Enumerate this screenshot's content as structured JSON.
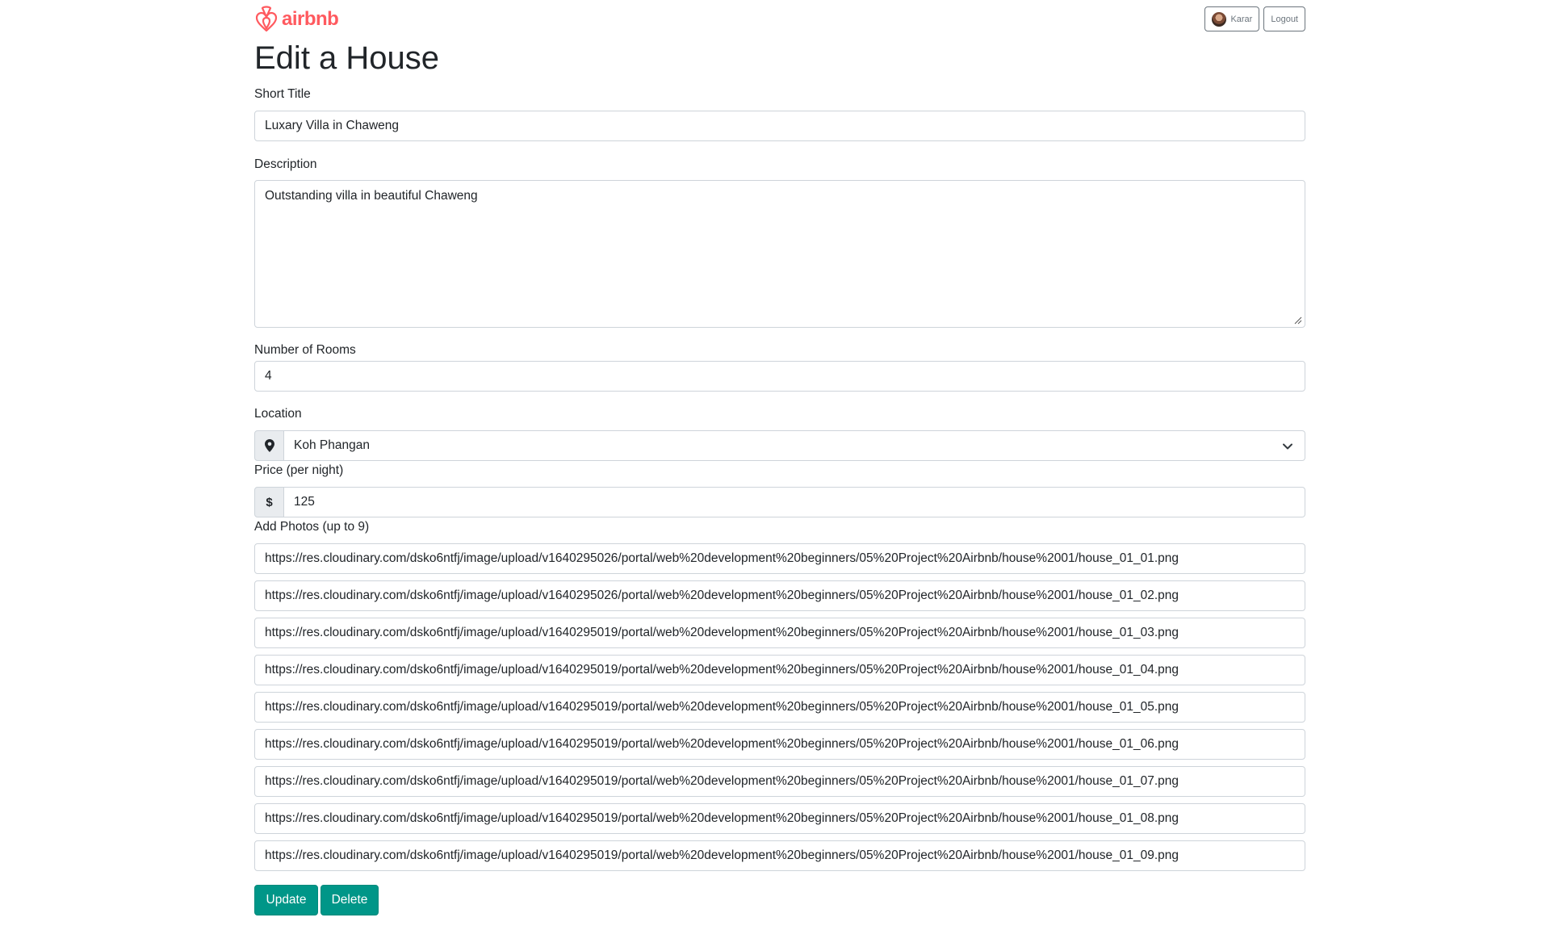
{
  "brand": {
    "name": "airbnb",
    "color": "#ff5a5f"
  },
  "nav": {
    "user_label": "Karar",
    "logout_label": "Logout"
  },
  "page": {
    "title": "Edit a House"
  },
  "form": {
    "title_label": "Short Title",
    "title_value": "Luxary Villa in Chaweng",
    "description_label": "Description",
    "description_value": "Outstanding villa in beautiful Chaweng",
    "rooms_label": "Number of Rooms",
    "rooms_value": "4",
    "location_label": "Location",
    "location_value": "Koh Phangan",
    "price_label": "Price (per night)",
    "price_prefix": "$",
    "price_value": "125",
    "photos_label": "Add Photos (up to 9)",
    "photos": [
      "https://res.cloudinary.com/dsko6ntfj/image/upload/v1640295026/portal/web%20development%20beginners/05%20Project%20Airbnb/house%2001/house_01_01.png",
      "https://res.cloudinary.com/dsko6ntfj/image/upload/v1640295026/portal/web%20development%20beginners/05%20Project%20Airbnb/house%2001/house_01_02.png",
      "https://res.cloudinary.com/dsko6ntfj/image/upload/v1640295019/portal/web%20development%20beginners/05%20Project%20Airbnb/house%2001/house_01_03.png",
      "https://res.cloudinary.com/dsko6ntfj/image/upload/v1640295019/portal/web%20development%20beginners/05%20Project%20Airbnb/house%2001/house_01_04.png",
      "https://res.cloudinary.com/dsko6ntfj/image/upload/v1640295019/portal/web%20development%20beginners/05%20Project%20Airbnb/house%2001/house_01_05.png",
      "https://res.cloudinary.com/dsko6ntfj/image/upload/v1640295019/portal/web%20development%20beginners/05%20Project%20Airbnb/house%2001/house_01_06.png",
      "https://res.cloudinary.com/dsko6ntfj/image/upload/v1640295019/portal/web%20development%20beginners/05%20Project%20Airbnb/house%2001/house_01_07.png",
      "https://res.cloudinary.com/dsko6ntfj/image/upload/v1640295019/portal/web%20development%20beginners/05%20Project%20Airbnb/house%2001/house_01_08.png",
      "https://res.cloudinary.com/dsko6ntfj/image/upload/v1640295019/portal/web%20development%20beginners/05%20Project%20Airbnb/house%2001/house_01_09.png"
    ],
    "update_label": "Update",
    "delete_label": "Delete"
  },
  "colors": {
    "accent": "#009688",
    "addon_bg": "#e9ecef",
    "border": "#ced4da"
  }
}
